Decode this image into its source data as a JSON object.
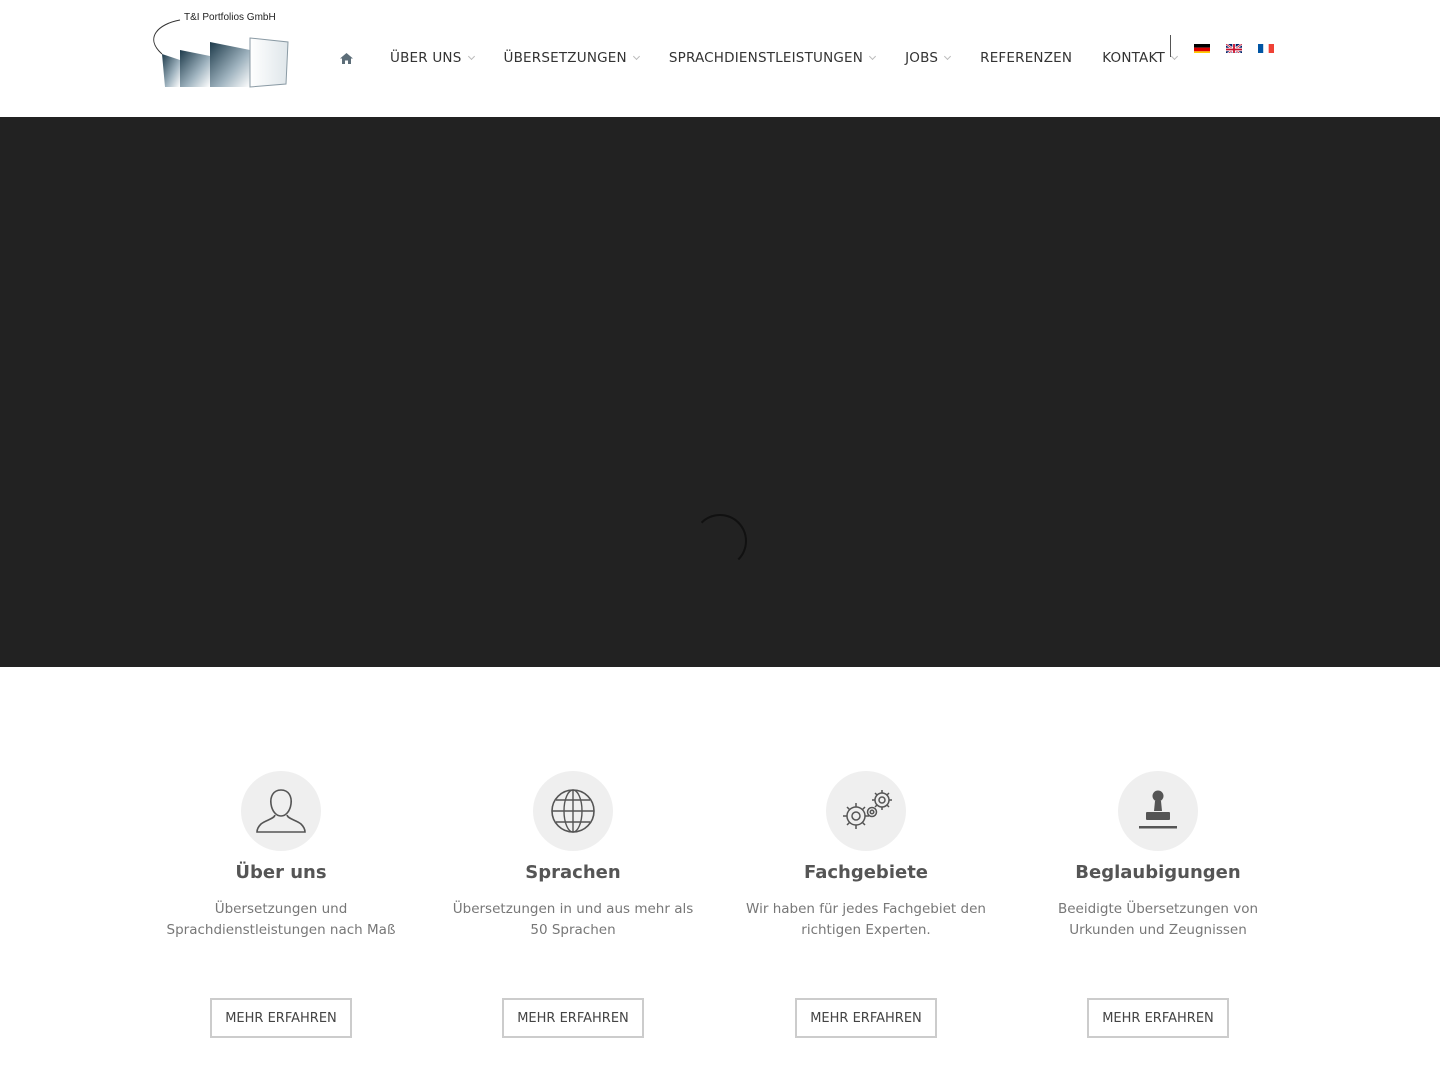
{
  "header": {
    "logo_text": "T&I Portfolios GmbH",
    "nav": [
      {
        "label": "ÜBER UNS",
        "dropdown": true
      },
      {
        "label": "ÜBERSETZUNGEN",
        "dropdown": true
      },
      {
        "label": "SPRACHDIENSTLEISTUNGEN",
        "dropdown": true
      },
      {
        "label": "JOBS",
        "dropdown": true
      },
      {
        "label": "REFERENZEN",
        "dropdown": false
      },
      {
        "label": "KONTAKT",
        "dropdown": true
      }
    ],
    "home_icon": "home-icon",
    "languages": [
      "de-flag-icon",
      "en-flag-icon",
      "fr-flag-icon"
    ]
  },
  "hero": {
    "background": "#222222",
    "loader_icon": "loading-spinner-icon"
  },
  "features": [
    {
      "icon": "user-icon",
      "title": "Über uns",
      "text": "Übersetzungen und Sprachdienstleistungen nach Maß",
      "button": "MEHR ERFAHREN"
    },
    {
      "icon": "globe-icon",
      "title": "Sprachen",
      "text": "Übersetzungen in und aus mehr als 50 Sprachen",
      "button": "MEHR ERFAHREN"
    },
    {
      "icon": "gears-icon",
      "title": "Fachgebiete",
      "text": "Wir haben für jedes Fachgebiet den richtigen Experten.",
      "button": "MEHR ERFAHREN"
    },
    {
      "icon": "stamp-icon",
      "title": "Beglaubigungen",
      "text": "Beeidigte Übersetzungen von Urkunden und Zeugnissen",
      "button": "MEHR ERFAHREN"
    }
  ]
}
